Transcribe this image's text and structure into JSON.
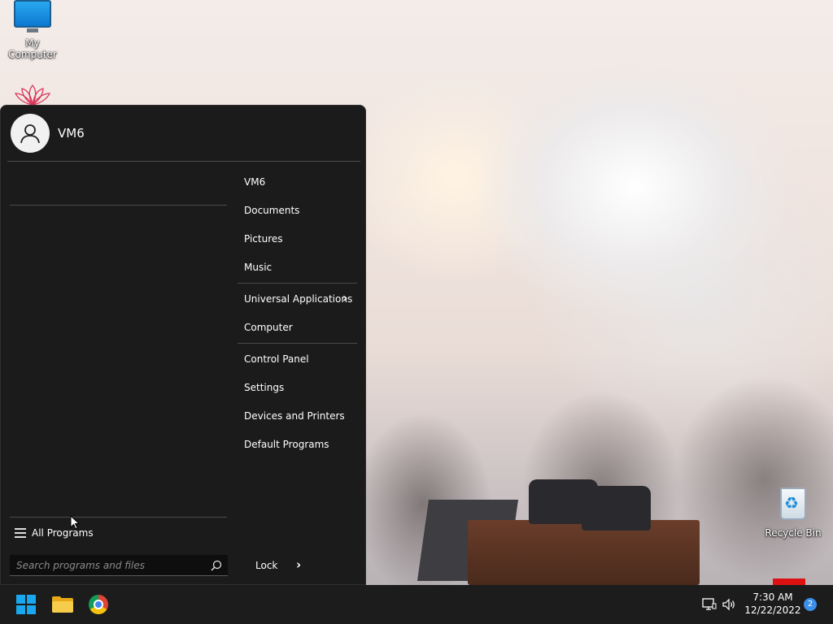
{
  "desktop": {
    "icons": [
      {
        "label": "My Computer",
        "icon": "monitor-icon"
      },
      {
        "label": "",
        "icon": "lotus-icon"
      },
      {
        "label": "Recycle Bin",
        "icon": "recycle-bin-icon"
      }
    ]
  },
  "start_menu": {
    "user_name": "VM6",
    "right_items": [
      {
        "label": "VM6"
      },
      {
        "label": "Documents"
      },
      {
        "label": "Pictures"
      },
      {
        "label": "Music"
      },
      {
        "label": "Universal Applications",
        "has_submenu": true
      },
      {
        "label": "Computer"
      },
      {
        "label": "Control Panel"
      },
      {
        "label": "Settings"
      },
      {
        "label": "Devices and Printers"
      },
      {
        "label": "Default Programs"
      }
    ],
    "all_programs_label": "All Programs",
    "search_placeholder": "Search programs and files",
    "lock_label": "Lock",
    "lock_arrow": "›"
  },
  "taskbar": {
    "pinned": [
      {
        "name": "start",
        "icon": "windows-logo-icon"
      },
      {
        "name": "file-explorer",
        "icon": "folder-icon"
      },
      {
        "name": "chrome",
        "icon": "chrome-icon"
      }
    ],
    "tray": {
      "network_icon": "network-icon",
      "volume_icon": "speaker-icon",
      "time": "7:30 AM",
      "date": "12/22/2022",
      "notification_count": "2"
    }
  },
  "colors": {
    "menu_bg": "#1b1b1b",
    "taskbar_bg": "#1c1c1c",
    "accent": "#19a8f0",
    "badge": "#3b8fe8"
  }
}
